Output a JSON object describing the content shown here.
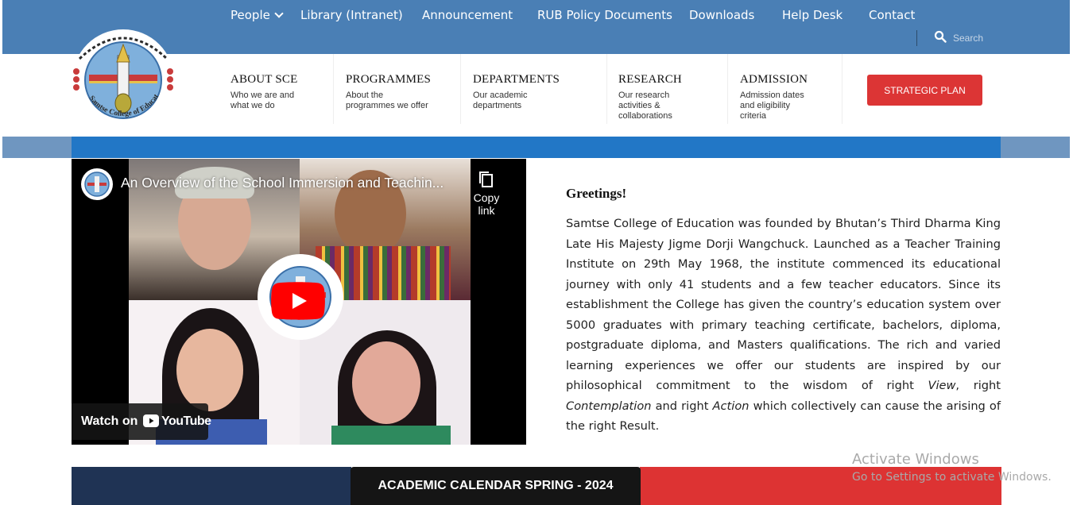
{
  "top_nav": {
    "items": [
      "People",
      "Library (Intranet)",
      "Announcement",
      "RUB Policy Documents",
      "Downloads",
      "Help Desk",
      "Contact"
    ],
    "search_placeholder": "Search"
  },
  "main_nav": {
    "items": [
      {
        "title": "ABOUT SCE",
        "sub": "Who we are and\nwhat we do"
      },
      {
        "title": "PROGRAMMES",
        "sub": "About the\nprogrammes we offer"
      },
      {
        "title": "DEPARTMENTS",
        "sub": "Our academic\ndepartments"
      },
      {
        "title": "RESEARCH",
        "sub": "Our research\nactivities &\ncollaborations"
      },
      {
        "title": "ADMISSION",
        "sub": "Admission dates\nand eligibility\ncriteria"
      }
    ],
    "cta": "STRATEGIC PLAN"
  },
  "logo": {
    "caption": "Samtse College of Education"
  },
  "video": {
    "title": "An Overview of the School Immersion and Teachin...",
    "copy_link": "Copy link",
    "watch_on": "Watch on",
    "youtube": "YouTube"
  },
  "greeting": {
    "heading": "Greetings!",
    "p1": "Samtse College of Education was founded by Bhutan’s Third Dharma King Late His Majesty Jigme Dorji Wangchuck. Launched as a Teacher Training Institute on 29th May 1968, the institute commenced its educational journey with only 41 students and a few teacher educators. Since its establishment the College has given the country’s education system over 5000 graduates with primary teaching certificate, bachelors, diploma, postgraduate diploma, and Masters qualifications. The rich and varied learning experiences we offer our students are inspired by our philosophical commitment to the wisdom of right ",
    "view": "View",
    "p2": ", right ",
    "contemplation": "Contemplation",
    "p3": " and right ",
    "action": "Action",
    "p4": " which collectively can cause the arising of the right Result."
  },
  "calendar": {
    "label": "ACADEMIC CALENDAR SPRING - 2024"
  },
  "watermark": {
    "line1": "Activate Windows",
    "line2": "Go to Settings to activate Windows."
  },
  "colors": {
    "topbar": "#4a7fb5",
    "accent_red": "#dc3535",
    "blue_band": "#2277c6",
    "navy": "#1f3354"
  }
}
